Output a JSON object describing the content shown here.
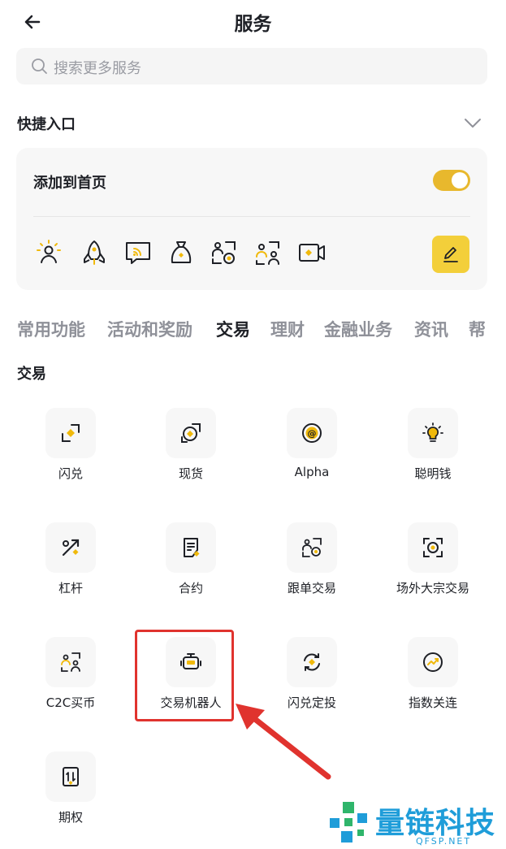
{
  "header": {
    "title": "服务"
  },
  "search": {
    "placeholder": "搜索更多服务"
  },
  "shortcuts": {
    "title": "快捷入口",
    "add_to_home_label": "添加到首页",
    "add_to_home_enabled": true,
    "icons": [
      "referral-person-icon",
      "rocket-icon",
      "broadcast-icon",
      "money-bag-icon",
      "copy-trade-icon",
      "c2c-users-icon",
      "live-video-icon"
    ]
  },
  "tabs": [
    {
      "label": "常用功能",
      "active": false
    },
    {
      "label": "活动和奖励",
      "active": false
    },
    {
      "label": "交易",
      "active": true
    },
    {
      "label": "理财",
      "active": false
    },
    {
      "label": "金融业务",
      "active": false
    },
    {
      "label": "资讯",
      "active": false
    },
    {
      "label": "帮",
      "active": false
    }
  ],
  "section": {
    "title": "交易"
  },
  "items": [
    {
      "label": "闪兑",
      "icon": "convert-icon"
    },
    {
      "label": "现货",
      "icon": "spot-icon"
    },
    {
      "label": "Alpha",
      "icon": "alpha-icon"
    },
    {
      "label": "聪明钱",
      "icon": "smart-money-icon"
    },
    {
      "label": "杠杆",
      "icon": "margin-percent-icon"
    },
    {
      "label": "合约",
      "icon": "futures-document-icon"
    },
    {
      "label": "跟单交易",
      "icon": "copy-trading-icon"
    },
    {
      "label": "场外大宗交易",
      "icon": "otc-block-icon"
    },
    {
      "label": "C2C买币",
      "icon": "c2c-icon"
    },
    {
      "label": "交易机器人",
      "icon": "trading-bot-icon"
    },
    {
      "label": "闪兑定投",
      "icon": "recurring-convert-icon"
    },
    {
      "label": "指数关连",
      "icon": "index-linked-icon"
    },
    {
      "label": "期权",
      "icon": "options-icon"
    }
  ],
  "watermark": {
    "text": "量链科技",
    "sub": "QFSP.NET"
  },
  "colors": {
    "accent": "#F0B90B",
    "toggle": "#E8B82D",
    "highlight": "#E0332E",
    "watermark": "#1F9DD9"
  }
}
